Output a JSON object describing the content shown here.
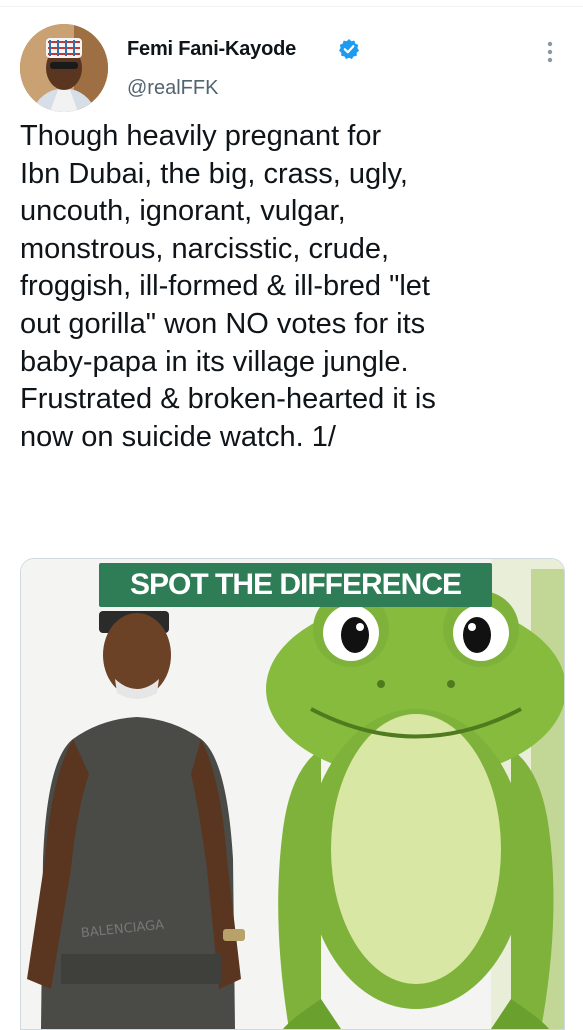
{
  "tweet": {
    "author_name": "Femi Fani-Kayode",
    "handle": "@realFFK",
    "verified": true,
    "text": "Though heavily pregnant for\nIbn Dubai, the big, crass, ugly,\nuncouth, ignorant, vulgar,\nmonstrous, narcisstic, crude,\nfroggish, ill-formed & ill-bred \"let\nout gorilla\" won NO votes for its\nbaby-papa in its village jungle.\nFrustrated & broken-hearted it is\nnow on suicide watch. 1/"
  },
  "media": {
    "banner_text": "SPOT THE DIFFERENCE"
  },
  "colors": {
    "text": "#0f1419",
    "secondary": "#536471",
    "verified_blue": "#1d9bf0",
    "banner_green": "#2f7d57",
    "frog_green": "#7fb23a",
    "frog_belly": "#d8e8a4"
  },
  "icons": {
    "verified": "verified-badge-icon",
    "more": "more-vertical-icon"
  }
}
